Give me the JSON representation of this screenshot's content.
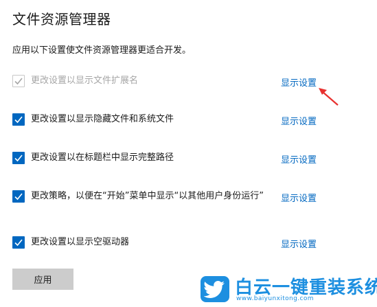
{
  "page": {
    "title": "文件资源管理器",
    "description": "应用以下设置使文件资源管理器更适合开发。"
  },
  "settings": [
    {
      "label": "更改设置以显示文件扩展名",
      "checked": true,
      "disabled": true,
      "link": "显示设置"
    },
    {
      "label": "更改设置以显示隐藏文件和系统文件",
      "checked": true,
      "disabled": false,
      "link": "显示设置"
    },
    {
      "label": "更改设置以在标题栏中显示完整路径",
      "checked": true,
      "disabled": false,
      "link": "显示设置"
    },
    {
      "label": "更改策略，以便在“开始”菜单中显示“以其他用户身份运行”",
      "checked": true,
      "disabled": false,
      "link": "显示设置"
    },
    {
      "label": "更改设置以显示空驱动器",
      "checked": true,
      "disabled": false,
      "link": "显示设置"
    }
  ],
  "actions": {
    "apply_label": "应用"
  },
  "watermark": {
    "name": "白云一键重装系统",
    "url": "www.baiyunxitong.com"
  },
  "colors": {
    "accent": "#0067c0",
    "disabled_text": "#a6a6a6",
    "button_bg": "#cccccc",
    "annotation_arrow": "#e8312f",
    "watermark": "#1d8fe0"
  },
  "icons": {
    "checkbox": "checkmark-icon",
    "annotation": "red-arrow-icon",
    "watermark_logo": "twitter-bird-icon"
  }
}
